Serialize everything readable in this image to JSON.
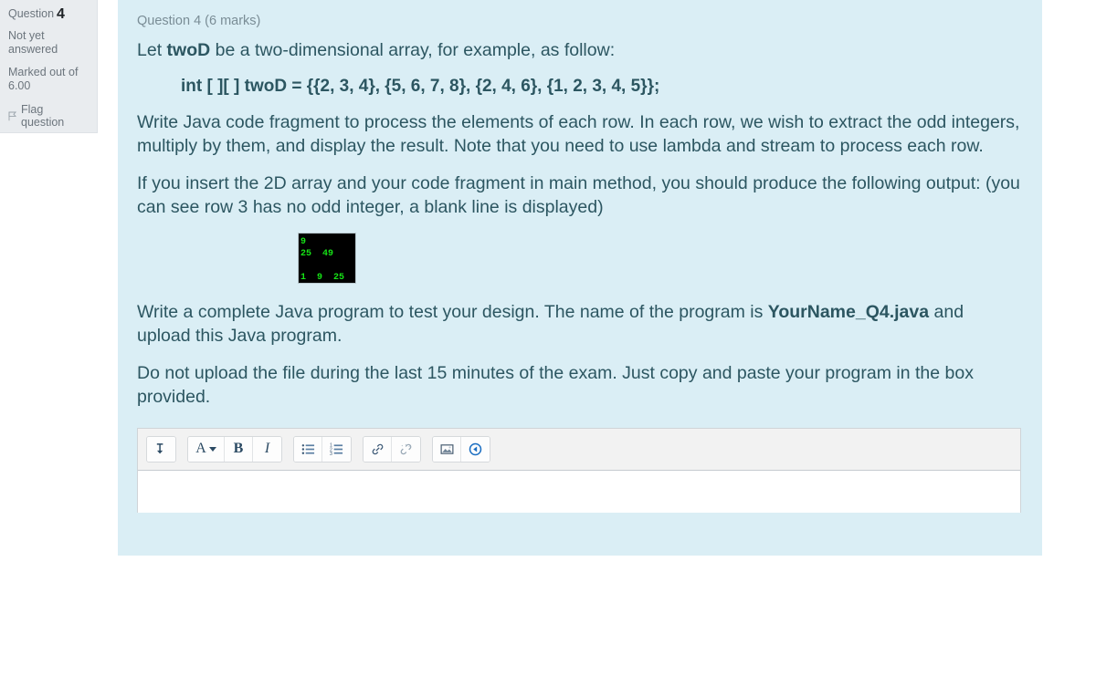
{
  "question_info": {
    "question_label": "Question",
    "question_number": "4",
    "state": "Not yet answered",
    "marks_label": "Marked out of",
    "marks_value": "6.00",
    "flag_label": "Flag question",
    "flag_icon": "flag-icon"
  },
  "question": {
    "header": "Question 4 (6 marks)",
    "intro_prefix": "Let ",
    "intro_bold": "twoD",
    "intro_suffix": " be a two-dimensional array, for example, as follow:",
    "code_declaration": "int [ ][ ] twoD = {{2, 3, 4}, {5, 6, 7, 8}, {2, 4, 6}, {1, 2, 3, 4, 5}};",
    "para_task": "Write Java code fragment to process the elements of each row.  In each row, we wish to extract the odd integers, multiply by them, and display the result. Note that you need to use lambda and stream to process each row.",
    "para_output": "If you insert the 2D array and your code fragment in main method, you should produce the following output: (you can see row 3 has no odd integer, a blank line is displayed)",
    "console_output": "9\n25  49\n\n1  9  25",
    "para_program_prefix": "Write a complete Java program to test your design. The name of the program is ",
    "para_program_bold": "YourName_Q4.java",
    "para_program_suffix": " and upload this Java program.",
    "para_warning": "Do not upload the file during the last 15 minutes of the exam. Just copy and paste your program in the box provided."
  },
  "editor": {
    "toolbar": [
      {
        "name": "expand-button",
        "icon": "arrow-down-bar-icon",
        "label": ""
      },
      {
        "name": "fontcolor-button",
        "icon": "letter-a-icon",
        "label": "A"
      },
      {
        "name": "bold-button",
        "icon": "bold-icon",
        "label": "B"
      },
      {
        "name": "italic-button",
        "icon": "italic-icon",
        "label": "I"
      },
      {
        "name": "bullet-list-button",
        "icon": "unordered-list-icon",
        "label": ""
      },
      {
        "name": "numbered-list-button",
        "icon": "ordered-list-icon",
        "label": ""
      },
      {
        "name": "link-button",
        "icon": "link-icon",
        "label": ""
      },
      {
        "name": "unlink-button",
        "icon": "unlink-icon",
        "label": ""
      },
      {
        "name": "image-button",
        "icon": "image-icon",
        "label": ""
      },
      {
        "name": "media-button",
        "icon": "media-play-icon",
        "label": ""
      }
    ],
    "answer_value": "",
    "answer_placeholder": ""
  },
  "colors": {
    "panel_bg": "#daeef5",
    "sidebar_bg": "#e9ecef",
    "text": "#2c5661",
    "muted": "#6c757d",
    "console_bg": "#000000",
    "console_text": "#16e316"
  }
}
